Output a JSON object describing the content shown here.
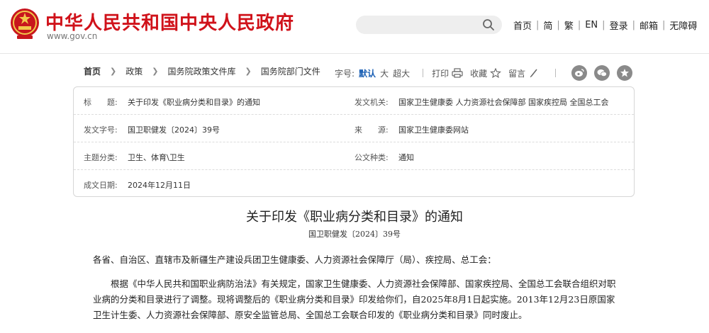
{
  "header": {
    "site_title": "中华人民共和国中央人民政府",
    "site_url": "www.gov.cn",
    "nav": [
      "首页",
      "简",
      "繁",
      "EN",
      "登录",
      "邮箱",
      "无障碍"
    ],
    "search_placeholder": ""
  },
  "breadcrumb": {
    "items": [
      "首页",
      "政策",
      "国务院政策文件库",
      "国务院部门文件"
    ]
  },
  "tools": {
    "font_label": "字号:",
    "font_sizes": [
      "默认",
      "大",
      "超大"
    ],
    "print": "打印",
    "favorite": "收藏",
    "comment": "留言"
  },
  "info": {
    "title_label": "标　　题:",
    "title_value": "关于印发《职业病分类和目录》的通知",
    "issuer_label": "发文机关:",
    "issuer_value": "国家卫生健康委 人力资源社会保障部 国家疾控局 全国总工会",
    "docno_label": "发文字号:",
    "docno_value": "国卫职健发〔2024〕39号",
    "source_label": "来　　源:",
    "source_value": "国家卫生健康委网站",
    "topic_label": "主题分类:",
    "topic_value": "卫生、体育\\卫生",
    "type_label": "公文种类:",
    "type_value": "通知",
    "date_label": "成文日期:",
    "date_value": "2024年12月11日"
  },
  "article": {
    "title": "关于印发《职业病分类和目录》的通知",
    "docno": "国卫职健发〔2024〕39号",
    "salutation": "各省、自治区、直辖市及新疆生产建设兵团卫生健康委、人力资源社会保障厅（局）、疾控局、总工会：",
    "body": "根据《中华人民共和国职业病防治法》有关规定，国家卫生健康委、人力资源社会保障部、国家疾控局、全国总工会联合组织对职业病的分类和目录进行了调整。现将调整后的《职业病分类和目录》印发给你们，自2025年8月1日起实施。2013年12月23日原国家卫生计生委、人力资源社会保障部、原安全监管总局、全国总工会联合印发的《职业病分类和目录》同时废止。"
  },
  "colors": {
    "brand_red": "#d0121a",
    "active_blue": "#1a5fb4"
  },
  "icons": [
    "national-emblem-icon",
    "search-icon",
    "print-icon",
    "star-icon",
    "pen-icon",
    "weibo-icon",
    "wechat-icon",
    "qzone-icon"
  ]
}
